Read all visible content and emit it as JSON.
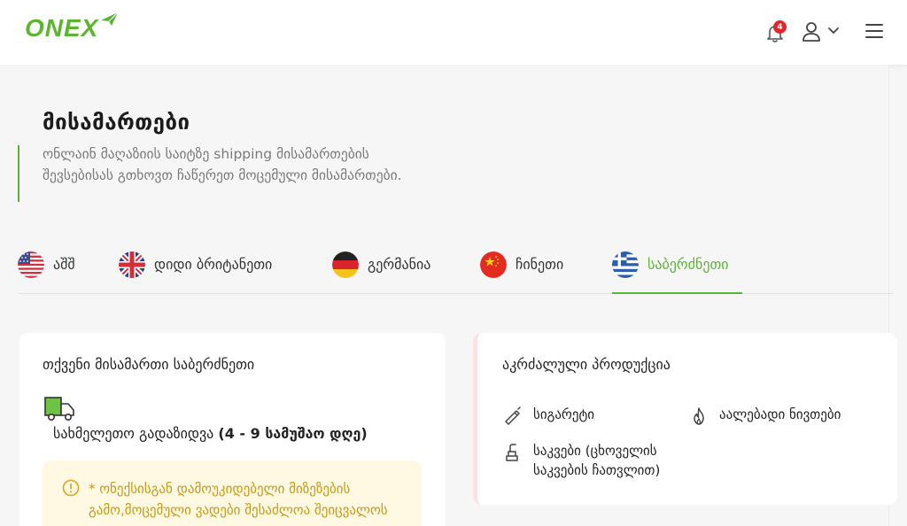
{
  "header": {
    "logo_text": "ONEX",
    "notification_count": "4"
  },
  "page": {
    "title": "მისამართები",
    "description": "ონლაინ მაღაზიის საიტზე shipping მისამართების შევსებისას გთხოვთ ჩაწერეთ მოცემული მისამართები."
  },
  "tabs": [
    {
      "label": "აშშ",
      "flag": "usa-flag-icon",
      "active": false
    },
    {
      "label": "დიდი ბრიტანეთი",
      "flag": "uk-flag-icon",
      "active": false
    },
    {
      "label": "გერმანია",
      "flag": "germany-flag-icon",
      "active": false
    },
    {
      "label": "ჩინეთი",
      "flag": "china-flag-icon",
      "active": false
    },
    {
      "label": "საბერძნეთი",
      "flag": "greece-flag-icon",
      "active": true
    }
  ],
  "address_card": {
    "title": "თქვენი მისამართი საბერძნეთი",
    "delivery_prefix": "სახმელეთო გადაზიდვა ",
    "delivery_time": "(4 - 9 სამუშაო დღე)",
    "warning": "* ონექსისგან დამოუკიდებელი მიზეზების გამო,მოცემული ვადები შესაძლოა შეიცვალოს"
  },
  "prohibited_card": {
    "title": "აკრძალული პროდუქცია",
    "items": [
      {
        "label": "სიგარეტი",
        "icon": "cigarette-icon"
      },
      {
        "label": "აალებადი ნივთები",
        "icon": "flame-icon"
      },
      {
        "label": "საკვები (ცხოველის საკვების ჩათვლით)",
        "icon": "food-icon"
      }
    ]
  },
  "colors": {
    "brand_green": "#5cb531",
    "badge_red": "#e0262a",
    "warning_bg": "#fff8e3",
    "warning_text": "#c69a16"
  }
}
